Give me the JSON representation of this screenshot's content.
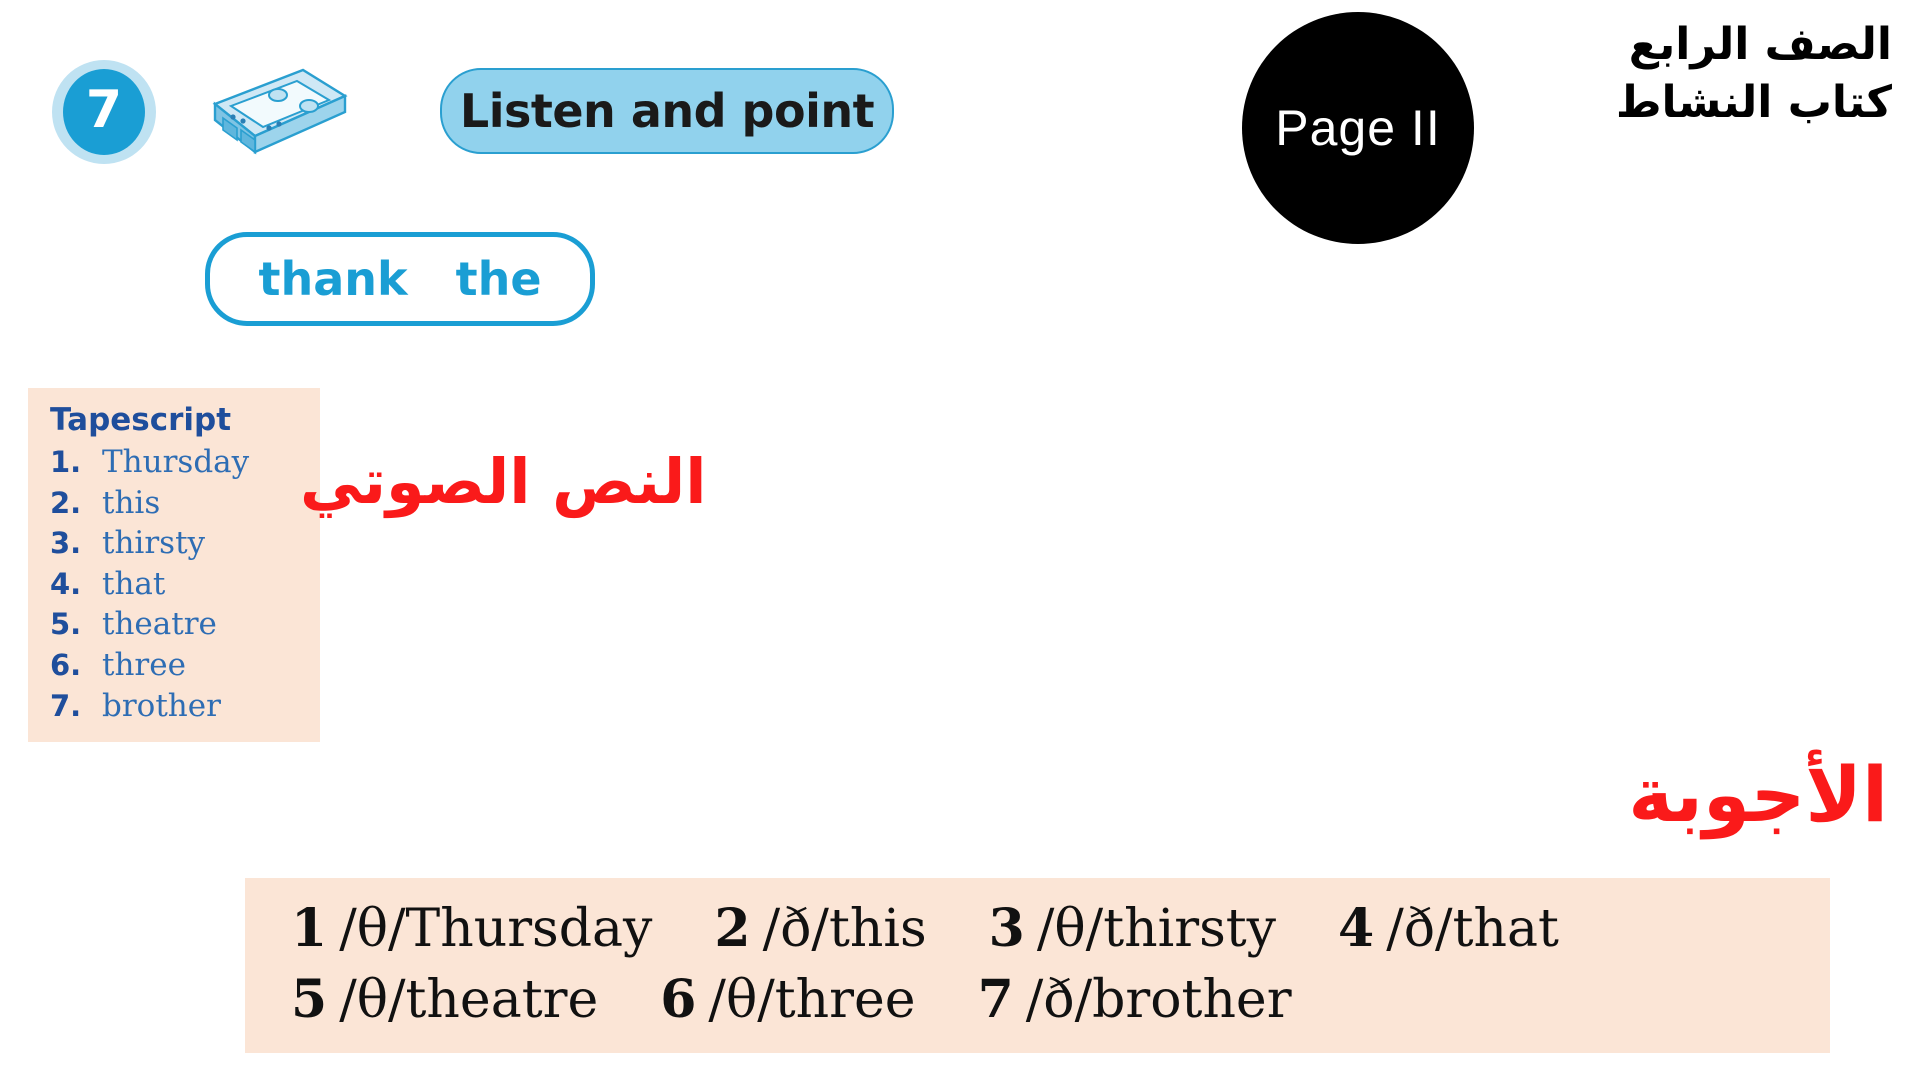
{
  "header": {
    "exercise_number": "7",
    "audio_icon": "cassette-tape-icon",
    "instruction": "Listen and point",
    "sample_words": [
      "thank",
      "the"
    ],
    "page_badge": "Page II",
    "grade_line1": "الصف الرابع",
    "grade_line2": "كتاب النشاط"
  },
  "tapescript": {
    "title": "Tapescript",
    "items": [
      {
        "num": "1.",
        "word": "Thursday"
      },
      {
        "num": "2.",
        "word": "this"
      },
      {
        "num": "3.",
        "word": "thirsty"
      },
      {
        "num": "4.",
        "word": "that"
      },
      {
        "num": "5.",
        "word": "theatre"
      },
      {
        "num": "6.",
        "word": "three"
      },
      {
        "num": "7.",
        "word": "brother"
      }
    ]
  },
  "labels": {
    "tapescript_arabic": "النص الصوتي",
    "answers_arabic": "الأجوبة"
  },
  "answers": {
    "row1": [
      {
        "num": "1",
        "text": "/θ/Thursday"
      },
      {
        "num": "2",
        "text": "/ð/this"
      },
      {
        "num": "3",
        "text": "/θ/thirsty"
      },
      {
        "num": "4",
        "text": "/ð/that"
      }
    ],
    "row2": [
      {
        "num": "5",
        "text": "/θ/theatre"
      },
      {
        "num": "6",
        "text": "/θ/three"
      },
      {
        "num": "7",
        "text": "/ð/brother"
      }
    ]
  },
  "colors": {
    "accent_blue": "#1a9ed4",
    "pill_blue": "#91d2ed",
    "box_peach": "#fbe5d6",
    "red": "#fa1a1a",
    "dark_blue": "#1f4e9c"
  }
}
